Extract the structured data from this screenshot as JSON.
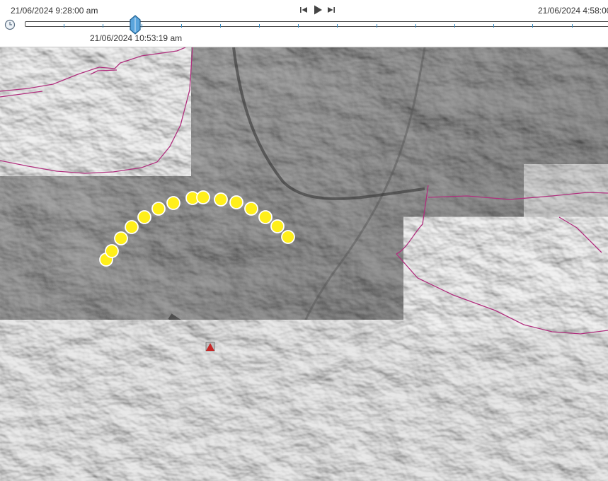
{
  "time_slider": {
    "start_time": "21/06/2024 9:28:00 am",
    "end_time": "21/06/2024 4:58:00",
    "current_time": "21/06/2024 10:53:19 am",
    "controls": {
      "previous": "skip-back-icon",
      "play": "play-icon",
      "next": "skip-forward-icon"
    },
    "tick_count": 15,
    "accent_color": "#2e86c1"
  },
  "map": {
    "terrain": "grayscale hillshade",
    "boundary_color": "#b0307e",
    "waypoint_color": "#ffef1a",
    "waypoint_count": 15,
    "marker": "red-triangle-icon"
  }
}
